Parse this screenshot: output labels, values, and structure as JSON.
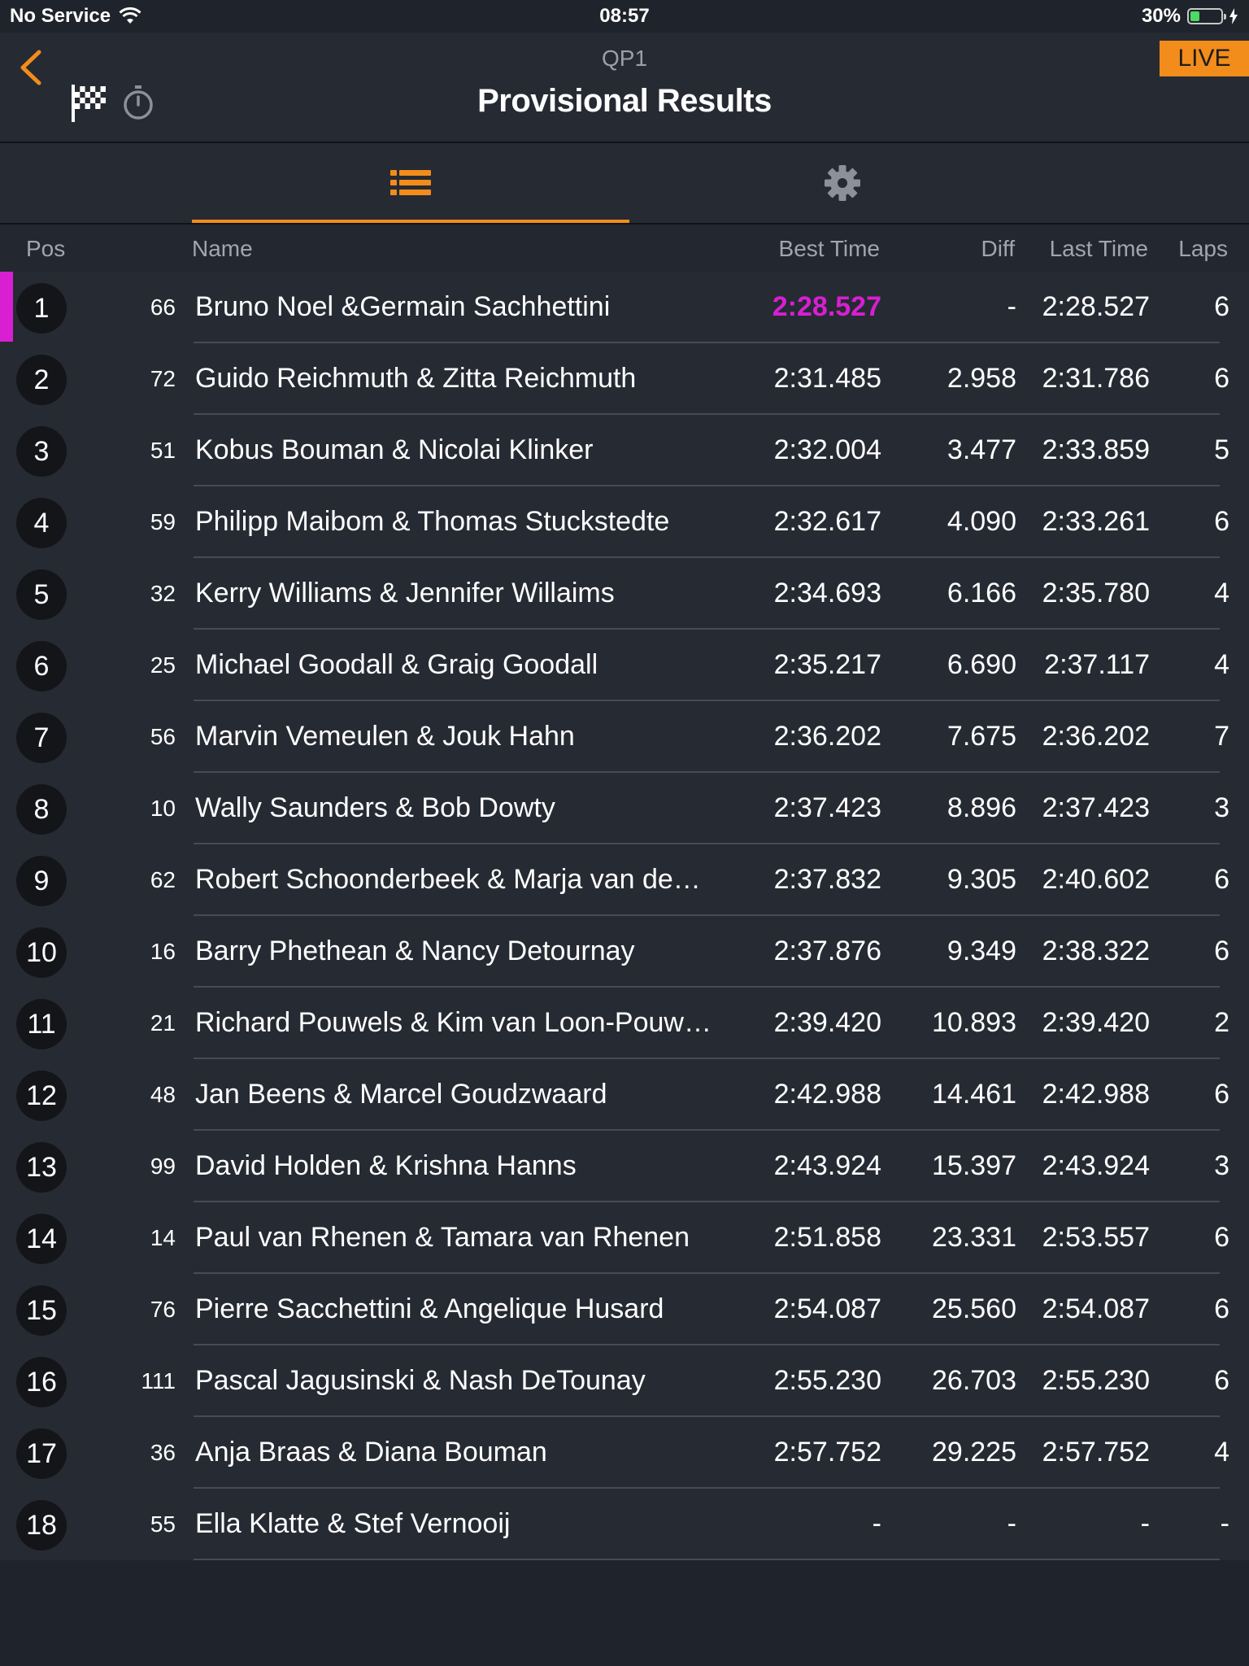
{
  "status_bar": {
    "carrier": "No Service",
    "time": "08:57",
    "battery": "30%",
    "battery_level": 0.3
  },
  "header": {
    "session": "QP1",
    "title": "Provisional Results",
    "live_badge": "LIVE",
    "accent": "#f28c1b"
  },
  "columns": {
    "pos": "Pos",
    "name": "Name",
    "best": "Best Time",
    "diff": "Diff",
    "last": "Last Time",
    "laps": "Laps"
  },
  "colors": {
    "fastest": "#d81fd2",
    "background": "#1f232b",
    "row": "#262a33"
  },
  "rows": [
    {
      "pos": "1",
      "num": "66",
      "name": "Bruno Noel &Germain Sachhettini",
      "best": "2:28.527",
      "diff": "-",
      "last": "2:28.527",
      "laps": "6",
      "fastest": true
    },
    {
      "pos": "2",
      "num": "72",
      "name": "Guido Reichmuth & Zitta Reichmuth",
      "best": "2:31.485",
      "diff": "2.958",
      "last": "2:31.786",
      "laps": "6"
    },
    {
      "pos": "3",
      "num": "51",
      "name": "Kobus Bouman & Nicolai Klinker",
      "best": "2:32.004",
      "diff": "3.477",
      "last": "2:33.859",
      "laps": "5"
    },
    {
      "pos": "4",
      "num": "59",
      "name": "Philipp Maibom & Thomas Stuckstedte",
      "best": "2:32.617",
      "diff": "4.090",
      "last": "2:33.261",
      "laps": "6"
    },
    {
      "pos": "5",
      "num": "32",
      "name": "Kerry Williams & Jennifer Willaims",
      "best": "2:34.693",
      "diff": "6.166",
      "last": "2:35.780",
      "laps": "4"
    },
    {
      "pos": "6",
      "num": "25",
      "name": "Michael Goodall & Graig Goodall",
      "best": "2:35.217",
      "diff": "6.690",
      "last": "2:37.117",
      "laps": "4"
    },
    {
      "pos": "7",
      "num": "56",
      "name": "Marvin Vemeulen & Jouk Hahn",
      "best": "2:36.202",
      "diff": "7.675",
      "last": "2:36.202",
      "laps": "7"
    },
    {
      "pos": "8",
      "num": "10",
      "name": "Wally Saunders & Bob Dowty",
      "best": "2:37.423",
      "diff": "8.896",
      "last": "2:37.423",
      "laps": "3"
    },
    {
      "pos": "9",
      "num": "62",
      "name": "Robert Schoonderbeek & Marja van de…",
      "best": "2:37.832",
      "diff": "9.305",
      "last": "2:40.602",
      "laps": "6"
    },
    {
      "pos": "10",
      "num": "16",
      "name": "Barry Phethean & Nancy Detournay",
      "best": "2:37.876",
      "diff": "9.349",
      "last": "2:38.322",
      "laps": "6"
    },
    {
      "pos": "11",
      "num": "21",
      "name": "Richard Pouwels & Kim van Loon-Pouw…",
      "best": "2:39.420",
      "diff": "10.893",
      "last": "2:39.420",
      "laps": "2"
    },
    {
      "pos": "12",
      "num": "48",
      "name": "Jan Beens & Marcel Goudzwaard",
      "best": "2:42.988",
      "diff": "14.461",
      "last": "2:42.988",
      "laps": "6"
    },
    {
      "pos": "13",
      "num": "99",
      "name": "David Holden & Krishna Hanns",
      "best": "2:43.924",
      "diff": "15.397",
      "last": "2:43.924",
      "laps": "3"
    },
    {
      "pos": "14",
      "num": "14",
      "name": "Paul van Rhenen & Tamara van Rhenen",
      "best": "2:51.858",
      "diff": "23.331",
      "last": "2:53.557",
      "laps": "6"
    },
    {
      "pos": "15",
      "num": "76",
      "name": "Pierre Sacchettini & Angelique Husard",
      "best": "2:54.087",
      "diff": "25.560",
      "last": "2:54.087",
      "laps": "6"
    },
    {
      "pos": "16",
      "num": "111",
      "name": "Pascal Jagusinski & Nash DeTounay",
      "best": "2:55.230",
      "diff": "26.703",
      "last": "2:55.230",
      "laps": "6"
    },
    {
      "pos": "17",
      "num": "36",
      "name": "Anja Braas & Diana Bouman",
      "best": "2:57.752",
      "diff": "29.225",
      "last": "2:57.752",
      "laps": "4"
    },
    {
      "pos": "18",
      "num": "55",
      "name": "Ella Klatte & Stef Vernooij",
      "best": "-",
      "diff": "-",
      "last": "-",
      "laps": "-"
    }
  ]
}
